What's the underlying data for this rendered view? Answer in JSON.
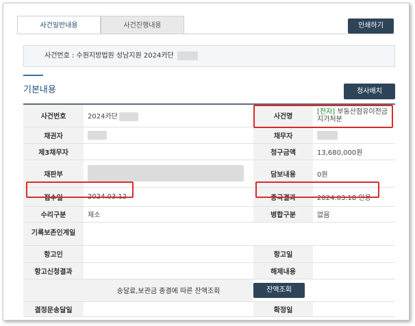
{
  "tabs": {
    "general": "사건일반내용",
    "progress": "사건진행내용"
  },
  "print_label": "인쇄하기",
  "case_header": "사건번호 : 수원지방법원 성남지원 2024카단",
  "section_title": "기본내용",
  "notify_label": "청사배치",
  "fields": {
    "case_no_label": "사건번호",
    "case_no_value": "2024카단",
    "case_name_label": "사건명",
    "case_name_tag": "[전자]",
    "case_name_value": "부동산점유이전금지가처분",
    "creditor_label": "채권자",
    "debtor_label": "채무자",
    "third_debtor_label": "제3채무자",
    "claim_label": "청구금액",
    "claim_value": "13,680,000원",
    "court_label": "재판부",
    "security_label": "담보내용",
    "security_value": "0원",
    "received_label": "접수일",
    "received_value": "2024.03.12",
    "result_label": "종국결과",
    "result_value": "2024.03.18 인용",
    "acceptance_label": "수리구분",
    "acceptance_value": "제소",
    "merge_label": "병합구분",
    "merge_value": "없음",
    "preserve_label": "기록보존인계일",
    "appellant_label": "항고인",
    "appeal_date_label": "항고일",
    "appeal_result_label": "항고신청결과",
    "release_label": "해제내용",
    "balance_text": "송달료,보관금 종결에 따른 잔액조회",
    "balance_btn": "잔액조회",
    "delivery_label": "결정문송달일",
    "confirm_label": "확정일"
  }
}
